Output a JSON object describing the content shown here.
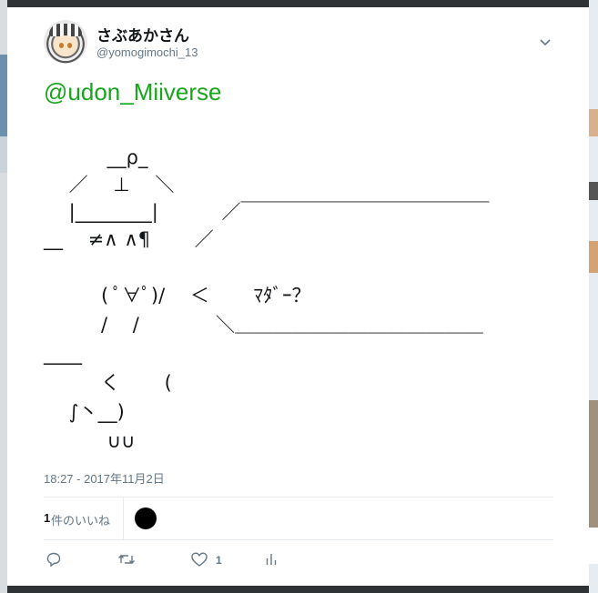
{
  "tweet": {
    "display_name": "さぶあかさん",
    "handle": "@yomogimochi_13",
    "mention": "@udon_Miiverse",
    "ascii_art_lines": [
      "　　　 __ρ_",
      "　 ／　 ⊥　 ＼",
      "　 |________|　　　 ／￣￣￣￣￣￣￣￣￣￣￣￣￣",
      "__　 ≠∧ ∧¶　　 ／",
      "　　　( ﾟ∀ﾟ)/　 ＜　　 ﾏﾀﾞｰ？",
      "　　　/　 /　　　　＼＿＿＿＿＿＿＿＿＿＿＿＿＿",
      "____",
      "　　　く　　 (",
      "　 ∫丶__)",
      "　　　 ∪∪"
    ],
    "timestamp": "18:27 - 2017年11月2日",
    "likes_count": "1",
    "likes_label": "件のいいね",
    "like_action_count": "1"
  },
  "icons": {
    "caret": "chevron-down-icon",
    "reply": "reply-icon",
    "retweet": "retweet-icon",
    "like": "heart-icon",
    "analytics": "analytics-icon"
  },
  "colors": {
    "mention": "#19a51d",
    "muted": "#657786",
    "text": "#14171a",
    "divider": "#e6ecf0"
  }
}
